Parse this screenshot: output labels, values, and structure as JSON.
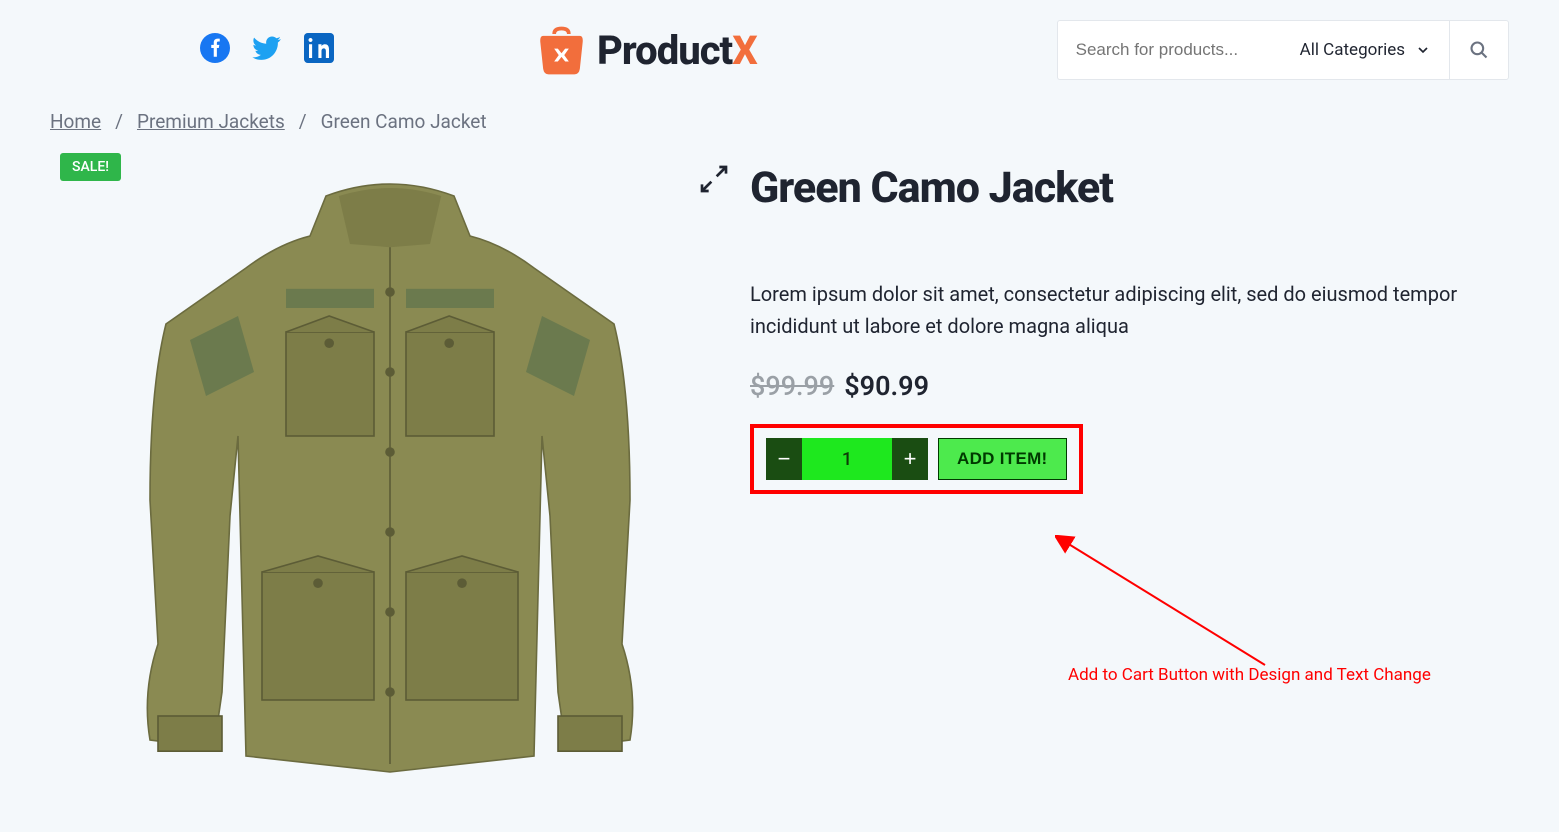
{
  "header": {
    "brand_part1": "Product",
    "brand_part2": "X",
    "search_placeholder": "Search for products...",
    "categories_label": "All Categories"
  },
  "breadcrumb": {
    "home": "Home",
    "category": "Premium Jackets",
    "current": "Green Camo Jacket"
  },
  "badge": {
    "sale": "SALE!"
  },
  "product": {
    "title": "Green Camo Jacket",
    "description": "Lorem ipsum dolor sit amet, consectetur adipiscing elit, sed do eiusmod tempor incididunt ut labore et dolore magna aliqua",
    "price_old": "$99.99",
    "price_new": "$90.99",
    "quantity": "1",
    "add_label": "ADD ITEM!"
  },
  "annotation": {
    "text": "Add to Cart Button with Design and Text Change"
  }
}
